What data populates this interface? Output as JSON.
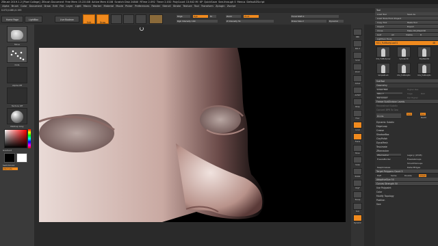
{
  "titlebar": {
    "items": [
      "ZBrush 2019.1.2 [Pixel College]",
      "ZBrush Document",
      "Free Mem 13.221GB",
      "Active Mem 4108",
      "Scratch Disk 24840",
      "RTime 2.092",
      "Timer 2.032",
      "PolyCount 13.642 MI",
      "KP",
      "QuickSave",
      "See-through 0",
      "Menus",
      "DefaultZScript"
    ]
  },
  "menubar": {
    "items": [
      "Alpha",
      "Brush",
      "Color",
      "Document",
      "Draw",
      "Edit",
      "File",
      "Layer",
      "Light",
      "Macro",
      "Marker",
      "Material",
      "Movie",
      "Picker",
      "Preferences",
      "Render",
      "Stencil",
      "Stroke",
      "Texture",
      "Tool",
      "Transform",
      "Zplugin",
      "Zscript"
    ]
  },
  "coords": "0.072,0.881,0.193",
  "topshelf": {
    "home": "Home Page",
    "lightbox": "LightBox",
    "liveboolean": "Live Boolean",
    "edit": "Edit",
    "draw": "Draw",
    "move": "Move",
    "scale": "Scale",
    "rotate": "Rotate",
    "mrgb": "Mrgb",
    "rgb": "Rgb",
    "m": "M",
    "rgb_intensity": "Rgb Intensity 100",
    "zadd": "Zadd",
    "zsub": "Zsub",
    "zintensity": "Z Intensity 51",
    "focal": "Focal Shift 0",
    "draw_size": "Draw Size 2",
    "dynamic": "Dynamic"
  },
  "leftpanel": {
    "brush": "Move",
    "stroke": "Dots",
    "alpha": "Alpha Off",
    "texture": "Texture Off",
    "material": "MatCap Gray",
    "gradient": "Gradient",
    "switch": "SwitchColor",
    "alternate": "Alternate"
  },
  "rightshelf": {
    "items": [
      "BPR",
      "SPix 3",
      "Scroll",
      "Zoom",
      "Actual",
      "AAHalf",
      "Persp",
      "Floor",
      "Local",
      "Frame",
      "Move",
      "Scale",
      "Rotate",
      "PolyF",
      "Transp",
      "Solo",
      "Dynamic"
    ]
  },
  "tool": {
    "header": "Tool",
    "rows": [
      "Load Tool",
      "Save As",
      "Load Tools From Project",
      "Copy Tool",
      "Paste Tool",
      "Import",
      "Export",
      "Clone",
      "Make PolyMesh3D",
      "GoZ",
      "All",
      "Visible",
      "R",
      "Lightbox Tools"
    ],
    "current": "KS1_FullBodyLow21",
    "count": "48",
    "thumbs": [
      "KS1_FullBodyLow",
      "Cylinder3D",
      "PolyMesh3D",
      "SimpleBrush",
      "KS1_FullBodyNo",
      "KS1_FullBodyNo"
    ],
    "ss": "3DiTy",
    "subtools": "SubTool",
    "geometry": "Geometry",
    "lower_res": "Lower Res",
    "higher_res": "Higher Res",
    "sdiv": "SDiv 7",
    "cage": "Cage",
    "rstr": "Rstr",
    "del_lower": "Del Lower",
    "del_higher": "Del Higher",
    "freeze": "Freeze SubDivision Levels",
    "reconstruct": "Reconstruct Subdiv",
    "convert": "Convert BPR To Geo",
    "divide": "Divide",
    "smt": "Smt",
    "suv": "Suv",
    "relgrid": "ReUV",
    "sections": [
      "Dynamic Subdiv",
      "EdgeLoop",
      "Crease",
      "ShadowBox",
      "ClayPolish",
      "DynaMesh",
      "Tessimate",
      "ZRemesher"
    ],
    "zremesher": "ZRemesher",
    "legacy": "Legacy (2018)",
    "freeze_border": "FreezeBorder",
    "freeze_groups": "FreezeGroups",
    "smooth_groups": "SmoothGroups",
    "keep_creases": "KeepCreases",
    "detect_edges": "DetectEdges",
    "target_count": "Target Polygons Count 5",
    "half": "Half",
    "same": "Same",
    "double": "Double",
    "adapt": "Adapt",
    "adaptive_size": "AdaptiveSize 50",
    "curves_strength": "Curves Strength 50",
    "use_polypaint": "Use Polypaint",
    "color": "Color",
    "modify_topology": "Modify Topology",
    "position": "Position",
    "size": "Size"
  },
  "colors": {
    "accent": "#f08a1e",
    "panel": "#3a3a3a",
    "bg": "#2a2a2a"
  }
}
